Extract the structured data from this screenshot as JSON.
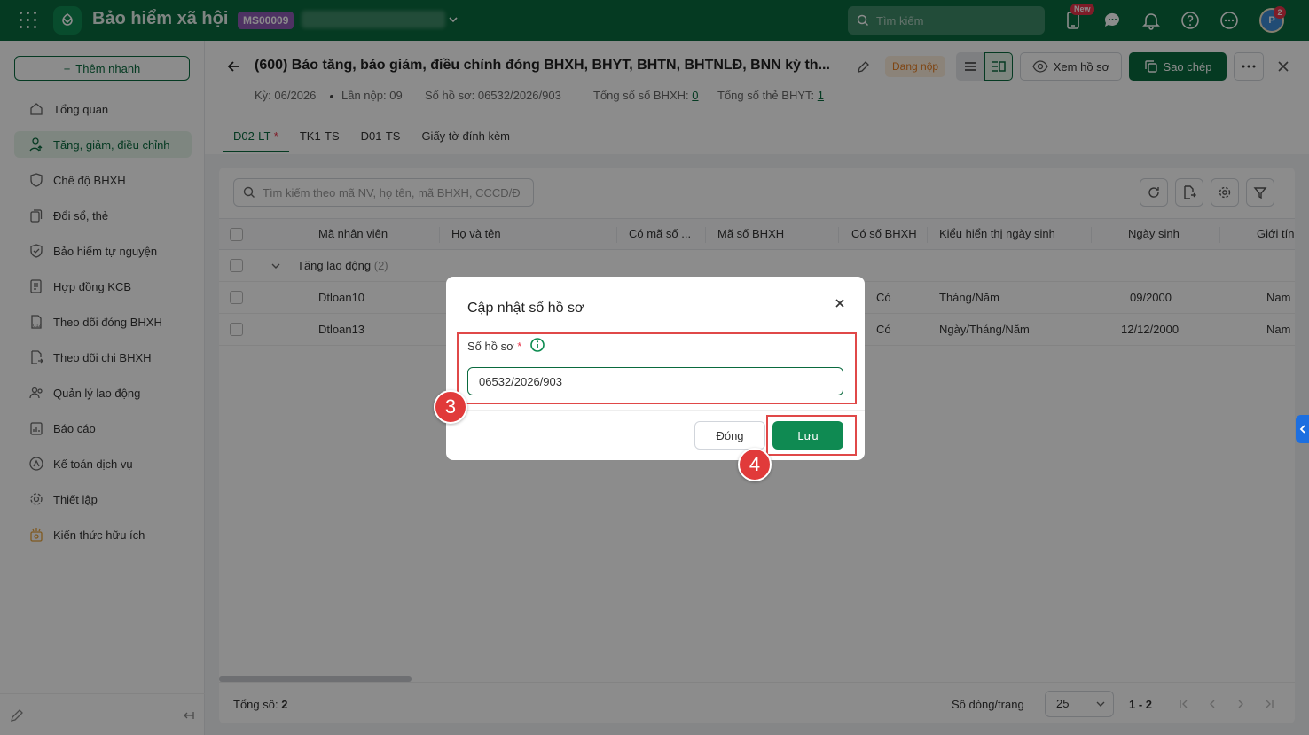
{
  "app": {
    "title": "Bảo hiểm xã hội",
    "company_code": "MS00009",
    "search_placeholder": "Tìm kiếm",
    "new_badge": "New",
    "avatar_initials": "P",
    "notification_count": "2"
  },
  "sidebar": {
    "quick_add": "Thêm nhanh",
    "items": [
      {
        "label": "Tổng quan",
        "icon": "home-icon"
      },
      {
        "label": "Tăng, giảm, điều chỉnh",
        "icon": "user-adjust-icon"
      },
      {
        "label": "Chế độ BHXH",
        "icon": "shield-heart-icon"
      },
      {
        "label": "Đổi sổ, thẻ",
        "icon": "card-swap-icon"
      },
      {
        "label": "Bảo hiểm tự nguyện",
        "icon": "shield-icon"
      },
      {
        "label": "Hợp đồng KCB",
        "icon": "contract-icon"
      },
      {
        "label": "Theo dõi đóng BHXH",
        "icon": "c12-doc-icon"
      },
      {
        "label": "Theo dõi chi BHXH",
        "icon": "doc-out-icon"
      },
      {
        "label": "Quản lý lao động",
        "icon": "people-icon"
      },
      {
        "label": "Báo cáo",
        "icon": "report-icon"
      },
      {
        "label": "Kế toán dịch vụ",
        "icon": "accounting-icon"
      },
      {
        "label": "Thiết lập",
        "icon": "gear-icon"
      },
      {
        "label": "Kiến thức hữu ích",
        "icon": "knowledge-icon"
      }
    ]
  },
  "header": {
    "title": "(600) Báo tăng, báo giảm, điều chỉnh đóng BHXH, BHYT, BHTN, BHTNLĐ, BNN kỳ th...",
    "status": "Đang nộp",
    "view_label": "Xem hồ sơ",
    "copy_label": "Sao chép",
    "meta": {
      "period": "Kỳ: 06/2026",
      "submission": "Lần nộp: 09",
      "dossier_label": "Số hồ sơ: 06532/2026/903",
      "bhxh_label": "Tổng số sổ BHXH: ",
      "bhxh_count": "0",
      "bhyt_label": "Tổng số thẻ BHYT: ",
      "bhyt_count": "1"
    },
    "tabs": [
      "D02-LT",
      "TK1-TS",
      "D01-TS",
      "Giấy tờ đính kèm"
    ],
    "tab_required_mark": "*"
  },
  "table": {
    "search_placeholder": "Tìm kiếm theo mã NV, họ tên, mã BHXH, CCCD/Đ",
    "columns": [
      "Mã nhân viên",
      "Họ và tên",
      "Có mã số ...",
      "Mã số BHXH",
      "Có số BHXH",
      "Kiểu hiển thị ngày sinh",
      "Ngày sinh",
      "Giới tính"
    ],
    "group": {
      "label": "Tăng lao động",
      "count": "(2)"
    },
    "rows": [
      {
        "ma_nv": "Dtloan10",
        "co_so_bhxh": "Có",
        "kieu_ngay_sinh": "Tháng/Năm",
        "ngay_sinh": "09/2000",
        "gioi_tinh": "Nam"
      },
      {
        "ma_nv": "Dtloan13",
        "co_so_bhxh": "Có",
        "kieu_ngay_sinh": "Ngày/Tháng/Năm",
        "ngay_sinh": "12/12/2000",
        "gioi_tinh": "Nam"
      }
    ],
    "footer": {
      "total_label": "Tổng số: ",
      "total": "2",
      "rows_per_page_label": "Số dòng/trang",
      "rows_per_page": "25",
      "range": "1 - 2"
    }
  },
  "modal": {
    "title": "Cập nhật số hồ sơ",
    "field_label": "Số hồ sơ",
    "required_mark": "*",
    "value": "06532/2026/903",
    "cancel": "Đóng",
    "save": "Lưu"
  },
  "annotations": {
    "step3": "3",
    "step4": "4"
  },
  "colors": {
    "brand": "#0a6a3e",
    "accent": "#0f8a52",
    "highlight": "#e04848",
    "status": "#e67c1f"
  }
}
